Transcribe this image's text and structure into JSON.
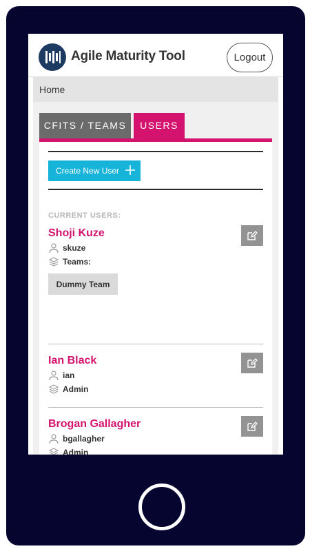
{
  "header": {
    "app_title": "Agile Maturity Tool",
    "logout_label": "Logout"
  },
  "breadcrumb": {
    "home_label": "Home"
  },
  "tabs": [
    {
      "label": "CFITS / TEAMS",
      "active": false
    },
    {
      "label": "USERS",
      "active": true
    }
  ],
  "actions": {
    "create_user_label": "Create New User"
  },
  "users_section": {
    "heading": "CURRENT USERS:",
    "users": [
      {
        "name": "Shoji Kuze",
        "username": "skuze",
        "role_label": "Teams:",
        "teams": [
          "Dummy Team"
        ]
      },
      {
        "name": "Ian Black",
        "username": "ian",
        "role_label": "Admin"
      },
      {
        "name": "Brogan Gallagher",
        "username": "bgallagher",
        "role_label": "Admin"
      }
    ]
  },
  "colors": {
    "accent": "#d4136e",
    "primary_button": "#16b4d9",
    "inactive_tab": "#6b6b6b",
    "device_frame": "#050530"
  }
}
